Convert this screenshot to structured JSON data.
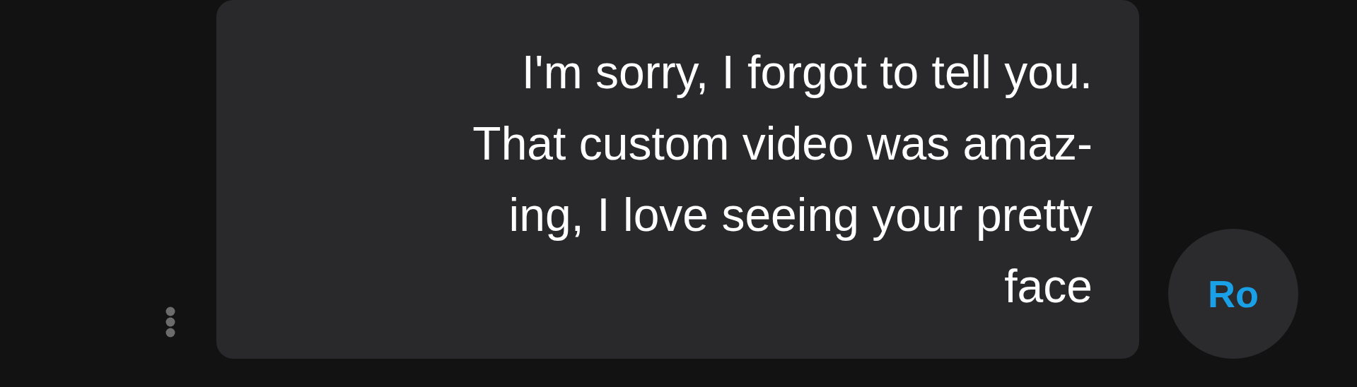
{
  "message": {
    "lines": [
      "I'm sorry, I forgot to tell you.",
      "That custom video was amaz-",
      "ing, I love seeing your pretty",
      "face"
    ]
  },
  "avatar": {
    "initials": "Ro"
  }
}
